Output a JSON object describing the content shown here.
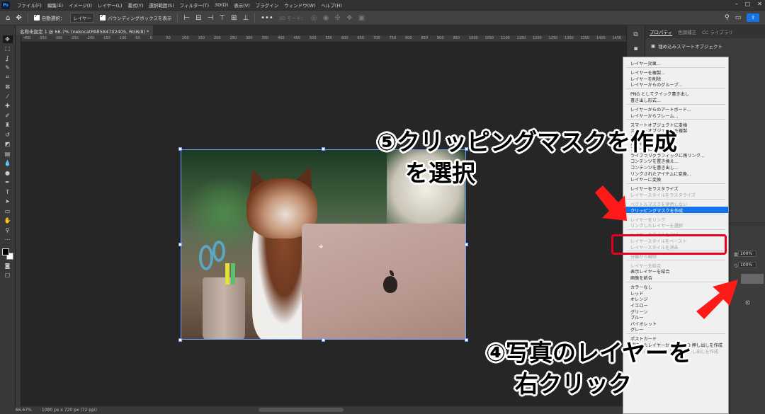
{
  "menubar": {
    "logo": "Ps",
    "items": [
      "ファイル(F)",
      "編集(E)",
      "イメージ(I)",
      "レイヤー(L)",
      "書式(Y)",
      "選択範囲(S)",
      "フィルター(T)",
      "3D(D)",
      "表示(V)",
      "プラグイン",
      "ウィンドウ(W)",
      "ヘルプ(H)"
    ]
  },
  "options": {
    "auto_select_label": "自動選択：",
    "auto_select_value": "レイヤー",
    "bounding_box_label": "バウンディングボックスを表示",
    "mode_3d_label": "3D モード："
  },
  "document": {
    "tab_title": "名称未設定 1 @ 66.7% (nekocatPAR584702405, RGB/8) *",
    "ruler_ticks": [
      "-400",
      "-350",
      "-300",
      "-250",
      "-200",
      "-150",
      "-100",
      "-50",
      "0",
      "50",
      "100",
      "150",
      "200",
      "250",
      "300",
      "350",
      "400",
      "450",
      "500",
      "550",
      "600",
      "650",
      "700",
      "750",
      "800",
      "850",
      "900",
      "950",
      "1000",
      "1050",
      "1100",
      "1150",
      "1200",
      "1250",
      "1300",
      "1350",
      "1400",
      "1450"
    ]
  },
  "status": {
    "zoom": "66.67%",
    "doc_size": "1080 px x 720 px (72 ppi)"
  },
  "properties": {
    "tabs": [
      "プロパティ",
      "色調補正",
      "CC ライブラリ"
    ],
    "object_type": "埋め込みスマートオブジェクト"
  },
  "layers": {
    "opacity_label": "度：",
    "opacity": "100%",
    "fill_label": "り：",
    "fill": "100%"
  },
  "context_menu": {
    "items": [
      {
        "label": "レイヤー効果...",
        "dim": false
      },
      {
        "label": "レイヤーを複製...",
        "dim": false
      },
      {
        "label": "レイヤーを削除",
        "dim": false
      },
      {
        "label": "レイヤーからのグループ...",
        "dim": false
      },
      {
        "label": "PNG としてクイック書き出し",
        "dim": false
      },
      {
        "label": "書き出し形式...",
        "dim": false
      },
      {
        "label": "レイヤーからのアートボード...",
        "dim": false
      },
      {
        "label": "レイヤーからフレーム...",
        "dim": false
      },
      {
        "label": "スマートオブジェクトに変換",
        "dim": false
      },
      {
        "label": "スマートオブジェクトを複製",
        "dim": false
      },
      {
        "label": "コンテンツを編集",
        "dim": false
      },
      {
        "label": "変形を初期化",
        "dim": false
      },
      {
        "label": "ファイルに再リンク...",
        "dim": false
      },
      {
        "label": "ライブラリグラフィックに再リンク...",
        "dim": false
      },
      {
        "label": "コンテンツを置き換え...",
        "dim": false
      },
      {
        "label": "コンテンツを書き出し...",
        "dim": false
      },
      {
        "label": "リンクされたアイテムに変換...",
        "dim": false
      },
      {
        "label": "レイヤーに変換",
        "dim": false
      },
      {
        "label": "レイヤーをラスタライズ",
        "dim": false
      },
      {
        "label": "レイヤースタイルをラスタライズ",
        "dim": true
      },
      {
        "label": "ベクトルマスクを使用しない",
        "dim": true
      },
      {
        "label": "クリッピングマスクを作成",
        "dim": false,
        "highlight": true
      },
      {
        "label": "レイヤーをリンク",
        "dim": true
      },
      {
        "label": "リンクしたレイヤーを選択",
        "dim": true
      },
      {
        "label": "レイヤースタイルをコピー",
        "dim": true
      },
      {
        "label": "レイヤースタイルをペースト",
        "dim": true
      },
      {
        "label": "レイヤースタイルを消去",
        "dim": true
      },
      {
        "label": "分離から解除",
        "dim": true
      },
      {
        "label": "レイヤーを結合",
        "dim": true
      },
      {
        "label": "表示レイヤーを結合",
        "dim": false
      },
      {
        "label": "画像を統合",
        "dim": false
      },
      {
        "label": "カラーなし",
        "dim": false
      },
      {
        "label": "レッド",
        "dim": false
      },
      {
        "label": "オレンジ",
        "dim": false
      },
      {
        "label": "イエロー",
        "dim": false
      },
      {
        "label": "グリーン",
        "dim": false
      },
      {
        "label": "ブルー",
        "dim": false
      },
      {
        "label": "バイオレット",
        "dim": false
      },
      {
        "label": "グレー",
        "dim": false
      },
      {
        "label": "ポストカード",
        "dim": false
      },
      {
        "label": "選択したレイヤーから新規 3D 押し出しを作成",
        "dim": false
      },
      {
        "label": "現在の選択範囲から新規 3D 押し出しを作成",
        "dim": true
      }
    ]
  },
  "annotations": {
    "step5_line1": "⑤クリッピングマスクを作成",
    "step5_line2": "を選択",
    "step4_line1": "④写真のレイヤーを",
    "step4_line2": "右クリック",
    "highlight_color": "#e8001c",
    "arrow_color": "#ff1a1a"
  }
}
